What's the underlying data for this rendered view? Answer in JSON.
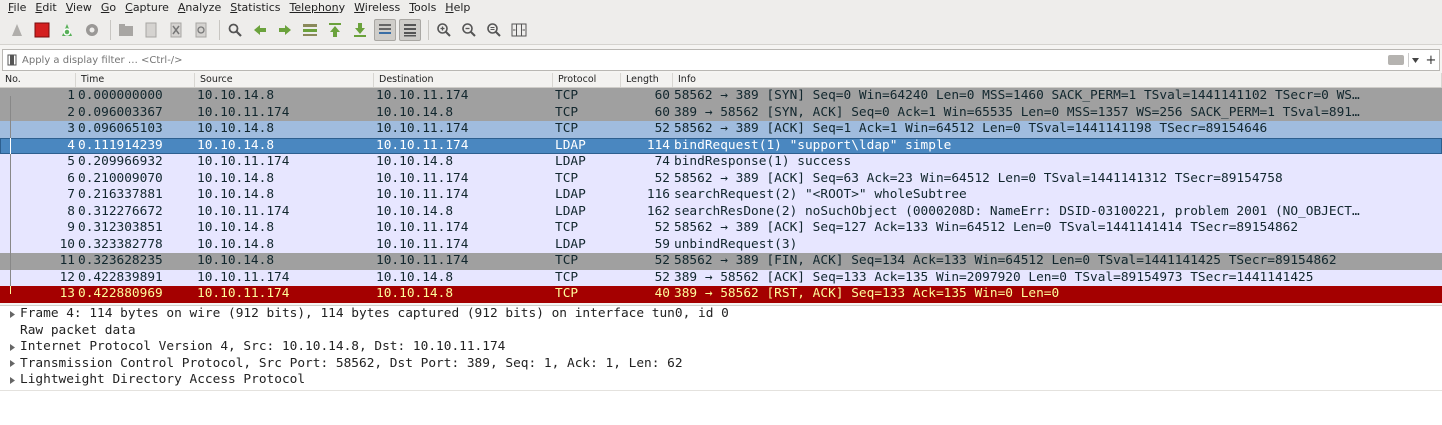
{
  "menubar": {
    "items": [
      {
        "label": "File",
        "ul": "F",
        "rest": "ile"
      },
      {
        "label": "Edit",
        "ul": "E",
        "rest": "dit"
      },
      {
        "label": "View",
        "ul": "V",
        "rest": "iew"
      },
      {
        "label": "Go",
        "ul": "G",
        "rest": "o"
      },
      {
        "label": "Capture",
        "ul": "C",
        "rest": "apture"
      },
      {
        "label": "Analyze",
        "ul": "A",
        "rest": "nalyze"
      },
      {
        "label": "Statistics",
        "ul": "S",
        "rest": "tatistics"
      },
      {
        "label": "Telephony",
        "ul": "Telephon",
        "rest": "y"
      },
      {
        "label": "Wireless",
        "ul": "W",
        "rest": "ireless"
      },
      {
        "label": "Tools",
        "ul": "T",
        "rest": "ools"
      },
      {
        "label": "Help",
        "ul": "H",
        "rest": "elp"
      }
    ]
  },
  "filter": {
    "placeholder": "Apply a display filter … <Ctrl-/>",
    "add_label": "+"
  },
  "columns": {
    "no": "No.",
    "time": "Time",
    "source": "Source",
    "destination": "Destination",
    "protocol": "Protocol",
    "length": "Length",
    "info": "Info"
  },
  "colors": {
    "tcp_gray": "#a0a0a0",
    "tcp_light": "#e7e6ff",
    "tcp_blue": "#a0bcde",
    "selected": "#4a87c0",
    "rst_red": "#a40000",
    "ldap_bg": "#e7e6ff"
  },
  "packets": [
    {
      "no": "1",
      "time": "0.000000000",
      "src": "10.10.14.8",
      "dst": "10.10.11.174",
      "proto": "TCP",
      "len": "60",
      "info": "58562 → 389 [SYN] Seq=0 Win=64240 Len=0 MSS=1460 SACK_PERM=1 TSval=1441141102 TSecr=0 WS…",
      "style": "gray"
    },
    {
      "no": "2",
      "time": "0.096003367",
      "src": "10.10.11.174",
      "dst": "10.10.14.8",
      "proto": "TCP",
      "len": "60",
      "info": "389 → 58562 [SYN, ACK] Seq=0 Ack=1 Win=65535 Len=0 MSS=1357 WS=256 SACK_PERM=1 TSval=891…",
      "style": "gray"
    },
    {
      "no": "3",
      "time": "0.096065103",
      "src": "10.10.14.8",
      "dst": "10.10.11.174",
      "proto": "TCP",
      "len": "52",
      "info": "58562 → 389 [ACK] Seq=1 Ack=1 Win=64512 Len=0 TSval=1441141198 TSecr=89154646",
      "style": "blue"
    },
    {
      "no": "4",
      "time": "0.111914239",
      "src": "10.10.14.8",
      "dst": "10.10.11.174",
      "proto": "LDAP",
      "len": "114",
      "info": "bindRequest(1) \"support\\ldap\" simple",
      "style": "selected"
    },
    {
      "no": "5",
      "time": "0.209966932",
      "src": "10.10.11.174",
      "dst": "10.10.14.8",
      "proto": "LDAP",
      "len": "74",
      "info": "bindResponse(1) success",
      "style": "light"
    },
    {
      "no": "6",
      "time": "0.210009070",
      "src": "10.10.14.8",
      "dst": "10.10.11.174",
      "proto": "TCP",
      "len": "52",
      "info": "58562 → 389 [ACK] Seq=63 Ack=23 Win=64512 Len=0 TSval=1441141312 TSecr=89154758",
      "style": "light"
    },
    {
      "no": "7",
      "time": "0.216337881",
      "src": "10.10.14.8",
      "dst": "10.10.11.174",
      "proto": "LDAP",
      "len": "116",
      "info": "searchRequest(2) \"<ROOT>\" wholeSubtree",
      "style": "light"
    },
    {
      "no": "8",
      "time": "0.312276672",
      "src": "10.10.11.174",
      "dst": "10.10.14.8",
      "proto": "LDAP",
      "len": "162",
      "info": "searchResDone(2) noSuchObject (0000208D: NameErr: DSID-03100221, problem 2001 (NO_OBJECT…",
      "style": "light"
    },
    {
      "no": "9",
      "time": "0.312303851",
      "src": "10.10.14.8",
      "dst": "10.10.11.174",
      "proto": "TCP",
      "len": "52",
      "info": "58562 → 389 [ACK] Seq=127 Ack=133 Win=64512 Len=0 TSval=1441141414 TSecr=89154862",
      "style": "light"
    },
    {
      "no": "10",
      "time": "0.323382778",
      "src": "10.10.14.8",
      "dst": "10.10.11.174",
      "proto": "LDAP",
      "len": "59",
      "info": "unbindRequest(3)",
      "style": "light"
    },
    {
      "no": "11",
      "time": "0.323628235",
      "src": "10.10.14.8",
      "dst": "10.10.11.174",
      "proto": "TCP",
      "len": "52",
      "info": "58562 → 389 [FIN, ACK] Seq=134 Ack=133 Win=64512 Len=0 TSval=1441141425 TSecr=89154862",
      "style": "gray"
    },
    {
      "no": "12",
      "time": "0.422839891",
      "src": "10.10.11.174",
      "dst": "10.10.14.8",
      "proto": "TCP",
      "len": "52",
      "info": "389 → 58562 [ACK] Seq=133 Ack=135 Win=2097920 Len=0 TSval=89154973 TSecr=1441141425",
      "style": "light"
    },
    {
      "no": "13",
      "time": "0.422880969",
      "src": "10.10.11.174",
      "dst": "10.10.14.8",
      "proto": "TCP",
      "len": "40",
      "info": "389 → 58562 [RST, ACK] Seq=133 Ack=135 Win=0 Len=0",
      "style": "red"
    }
  ],
  "details": [
    {
      "text": "Frame 4: 114 bytes on wire (912 bits), 114 bytes captured (912 bits) on interface tun0, id 0",
      "expandable": true
    },
    {
      "text": "Raw packet data",
      "expandable": false
    },
    {
      "text": "Internet Protocol Version 4, Src: 10.10.14.8, Dst: 10.10.11.174",
      "expandable": true
    },
    {
      "text": "Transmission Control Protocol, Src Port: 58562, Dst Port: 389, Seq: 1, Ack: 1, Len: 62",
      "expandable": true
    },
    {
      "text": "Lightweight Directory Access Protocol",
      "expandable": true
    }
  ]
}
